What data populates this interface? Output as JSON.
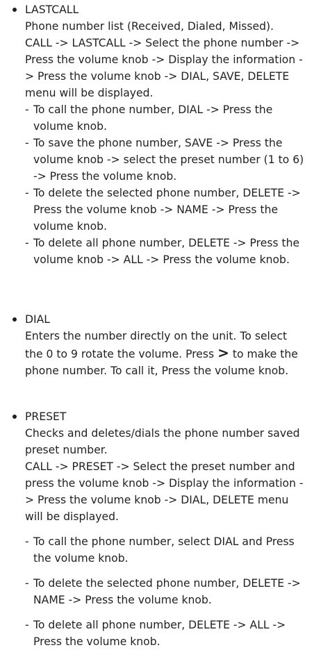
{
  "sections": [
    {
      "title": "LASTCALL",
      "lines": [
        "Phone number list (Received, Dialed, Missed).",
        "CALL -> LASTCALL -> Select the phone number -> Press the volume knob -> Display the information -> Press the volume knob -> DIAL, SAVE, DELETE menu will be displayed."
      ],
      "items": [
        "To call the phone number, DIAL -> Press the volume knob.",
        "To save the phone number, SAVE -> Press the volume knob -> select the preset number (1 to 6) -> Press the volume knob.",
        "To delete the selected phone number, DELETE -> Press the volume knob -> NAME -> Press the volume knob.",
        "To delete all phone number, DELETE -> Press the volume knob -> ALL -> Press the volume knob."
      ]
    },
    {
      "title": "DIAL",
      "text_before": "Enters the number directly on the unit. To select the 0 to 9 rotate the volume. Press",
      "glyph": ">",
      "text_after": "to make the phone number. To call it, Press the volume knob."
    },
    {
      "title": "PRESET",
      "lines": [
        "Checks and deletes/dials the phone number saved preset number.",
        "CALL -> PRESET -> Select the preset number and press the volume knob -> Display the information -> Press the volume knob -> DIAL, DELETE menu will be displayed."
      ],
      "items": [
        "To call the phone number, select DIAL and Press the volume knob.",
        "To delete the selected phone number, DELETE -> NAME -> Press the volume knob.",
        "To delete all phone number, DELETE -> ALL -> Press the volume knob."
      ]
    }
  ]
}
